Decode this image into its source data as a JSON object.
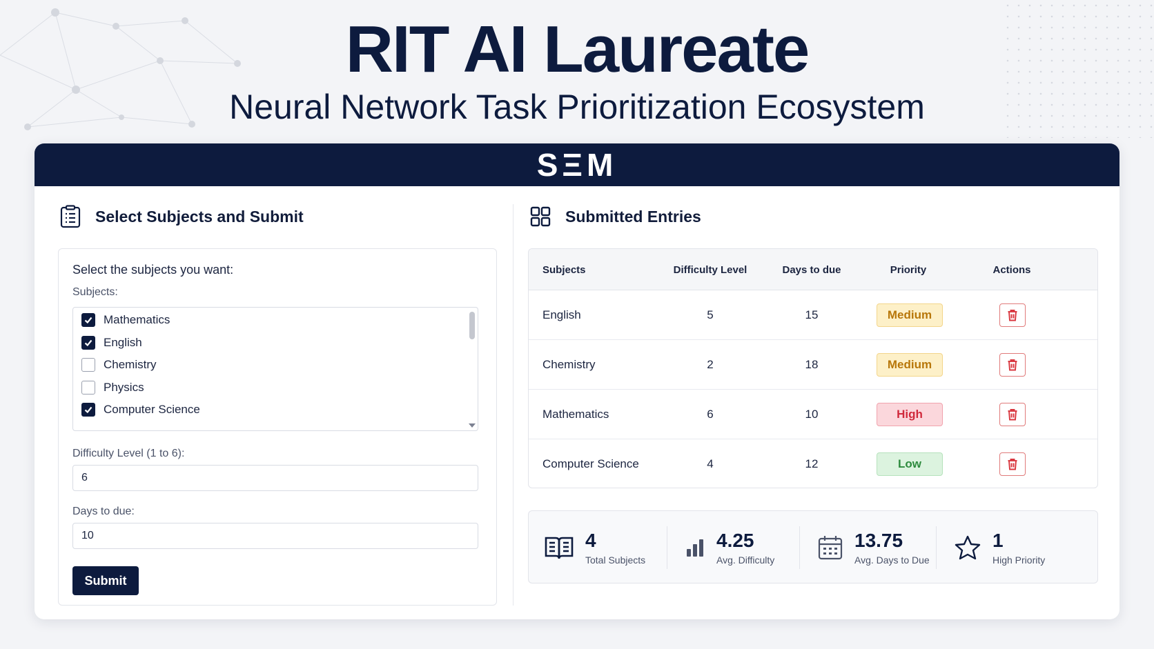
{
  "hero": {
    "title": "RIT AI Laureate",
    "subtitle": "Neural Network Task Prioritization Ecosystem"
  },
  "brand": "SΞM",
  "form": {
    "section_title": "Select Subjects and Submit",
    "prompt": "Select the subjects you want:",
    "subjects_label": "Subjects:",
    "subjects": [
      {
        "label": "Mathematics",
        "checked": true
      },
      {
        "label": "English",
        "checked": true
      },
      {
        "label": "Chemistry",
        "checked": false
      },
      {
        "label": "Physics",
        "checked": false
      },
      {
        "label": "Computer Science",
        "checked": true
      }
    ],
    "difficulty_label": "Difficulty Level (1 to 6):",
    "difficulty_value": "6",
    "days_label": "Days to due:",
    "days_value": "10",
    "submit_label": "Submit"
  },
  "entries": {
    "section_title": "Submitted Entries",
    "columns": [
      "Subjects",
      "Difficulty Level",
      "Days to due",
      "Priority",
      "Actions"
    ],
    "rows": [
      {
        "subject": "English",
        "difficulty": "5",
        "days": "15",
        "priority": "Medium"
      },
      {
        "subject": "Chemistry",
        "difficulty": "2",
        "days": "18",
        "priority": "Medium"
      },
      {
        "subject": "Mathematics",
        "difficulty": "6",
        "days": "10",
        "priority": "High"
      },
      {
        "subject": "Computer Science",
        "difficulty": "4",
        "days": "12",
        "priority": "Low"
      }
    ]
  },
  "priority_colors": {
    "Medium": {
      "bg": "#fdf0c8",
      "border": "#f3d58a",
      "text": "#b8770a"
    },
    "High": {
      "bg": "#fbd7dc",
      "border": "#f1a3ad",
      "text": "#d02a3c"
    },
    "Low": {
      "bg": "#dcf3df",
      "border": "#b6e2bc",
      "text": "#2e8b3e"
    }
  },
  "stats": [
    {
      "value": "4",
      "label": "Total Subjects",
      "icon": "book-icon"
    },
    {
      "value": "4.25",
      "label": "Avg. Difficulty",
      "icon": "bar-chart-icon"
    },
    {
      "value": "13.75",
      "label": "Avg. Days to Due",
      "icon": "calendar-icon"
    },
    {
      "value": "1",
      "label": "High Priority",
      "icon": "star-icon"
    }
  ],
  "colors": {
    "navy": "#0d1b3e",
    "delete": "#d9363e"
  }
}
